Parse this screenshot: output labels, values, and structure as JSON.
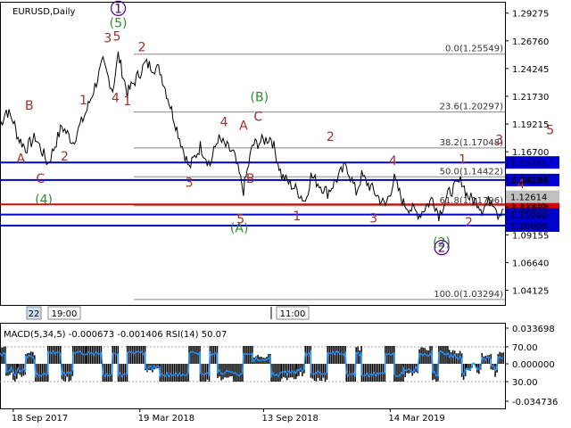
{
  "chart_data": {
    "type": "line",
    "title": "EURUSD,Daily",
    "y_axis": {
      "ticks": [
        "1.29275",
        "1.26760",
        "1.24245",
        "1.21730",
        "1.19215",
        "1.16700",
        "1.14185",
        "1.11670",
        "1.09155",
        "1.06640",
        "1.04125"
      ],
      "ylim": [
        1.028,
        1.303
      ]
    },
    "x_axis": {
      "ticks": [
        "18 Sep 2017",
        "19 Mar 2018",
        "13 Sep 2018",
        "14 Mar 2019"
      ],
      "xlim": [
        "2017-08-30",
        "2019-08-26"
      ],
      "time_markers": [
        "22",
        "19:00",
        "11:00"
      ]
    },
    "price_series": {
      "name": "EURUSD",
      "points": [
        [
          "2017-08-30",
          1.19
        ],
        [
          "2017-09-08",
          1.205
        ],
        [
          "2017-09-18",
          1.195
        ],
        [
          "2017-09-25",
          1.18
        ],
        [
          "2017-10-06",
          1.17
        ],
        [
          "2017-10-20",
          1.18
        ],
        [
          "2017-11-07",
          1.156
        ],
        [
          "2017-11-27",
          1.19
        ],
        [
          "2017-12-13",
          1.176
        ],
        [
          "2018-01-02",
          1.205
        ],
        [
          "2018-01-25",
          1.248
        ],
        [
          "2018-02-08",
          1.223
        ],
        [
          "2018-02-16",
          1.255
        ],
        [
          "2018-03-01",
          1.22
        ],
        [
          "2018-03-27",
          1.247
        ],
        [
          "2018-04-17",
          1.241
        ],
        [
          "2018-05-15",
          1.18
        ],
        [
          "2018-05-29",
          1.152
        ],
        [
          "2018-06-14",
          1.172
        ],
        [
          "2018-06-28",
          1.155
        ],
        [
          "2018-07-09",
          1.179
        ],
        [
          "2018-08-01",
          1.165
        ],
        [
          "2018-08-15",
          1.132
        ],
        [
          "2018-08-28",
          1.173
        ],
        [
          "2018-09-24",
          1.18
        ],
        [
          "2018-10-09",
          1.145
        ],
        [
          "2018-10-31",
          1.132
        ],
        [
          "2018-11-12",
          1.122
        ],
        [
          "2018-11-20",
          1.145
        ],
        [
          "2018-12-14",
          1.13
        ],
        [
          "2019-01-10",
          1.155
        ],
        [
          "2019-01-24",
          1.13
        ],
        [
          "2019-02-01",
          1.145
        ],
        [
          "2019-03-07",
          1.118
        ],
        [
          "2019-03-20",
          1.142
        ],
        [
          "2019-04-02",
          1.12
        ],
        [
          "2019-04-25",
          1.11
        ],
        [
          "2019-05-14",
          1.125
        ],
        [
          "2019-05-23",
          1.11
        ],
        [
          "2019-06-07",
          1.13
        ],
        [
          "2019-06-25",
          1.141
        ],
        [
          "2019-07-02",
          1.128
        ],
        [
          "2019-07-10",
          1.123
        ],
        [
          "2019-07-17",
          1.122
        ],
        [
          "2019-07-24",
          1.115
        ],
        [
          "2019-08-06",
          1.124
        ],
        [
          "2019-08-12",
          1.12
        ],
        [
          "2019-08-16",
          1.11
        ],
        [
          "2019-08-26",
          1.119
        ]
      ]
    },
    "fibonacci_levels": [
      {
        "label": "0.0(1.25549)",
        "value": 1.25549
      },
      {
        "label": "23.6(1.20297)",
        "value": 1.20297
      },
      {
        "label": "38.2(1.17048)",
        "value": 1.17048
      },
      {
        "label": "50.0(1.14422)",
        "value": 1.14422
      },
      {
        "label": "61.8(1.11796)",
        "value": 1.11796
      },
      {
        "label": "100.0(1.03294)",
        "value": 1.03294
      }
    ],
    "horizontal_levels": [
      {
        "value": 1.15725,
        "label": "1.15725",
        "color": "#0000cc"
      },
      {
        "value": 1.14134,
        "label": "1.14134",
        "color": "#0000cc"
      },
      {
        "value": 1.11915,
        "label": "1.11915",
        "color": "#dd0000"
      },
      {
        "value": 1.11,
        "label": "1.11000",
        "color": "#0000cc"
      },
      {
        "value": 1.1,
        "label": "1.10000",
        "color": "#0000cc"
      }
    ],
    "current_price": {
      "label": "1.12614",
      "value": 1.12614
    },
    "wave_labels": [
      {
        "text": "1",
        "date": "2018-02-16",
        "price": 1.293,
        "color": "#4b0082",
        "circled": true
      },
      {
        "text": "(5)",
        "date": "2018-02-16",
        "price": 1.28,
        "color": "#2e8b2e",
        "circled": false
      },
      {
        "text": "3",
        "date": "2018-02-01",
        "price": 1.266,
        "color": "#a0302c",
        "circled": false
      },
      {
        "text": "5",
        "date": "2018-02-14",
        "price": 1.268,
        "color": "#a0302c",
        "circled": false
      },
      {
        "text": "2",
        "date": "2018-03-22",
        "price": 1.258,
        "color": "#a0302c",
        "circled": false
      },
      {
        "text": "4",
        "date": "2018-02-12",
        "price": 1.212,
        "color": "#a0302c",
        "circled": false
      },
      {
        "text": "1",
        "date": "2018-03-01",
        "price": 1.209,
        "color": "#a0302c",
        "circled": false
      },
      {
        "text": "1",
        "date": "2017-12-28",
        "price": 1.21,
        "color": "#a0302c",
        "circled": false
      },
      {
        "text": "B",
        "date": "2017-10-11",
        "price": 1.205,
        "color": "#a0302c",
        "circled": false
      },
      {
        "text": "A",
        "date": "2017-09-29",
        "price": 1.157,
        "color": "#a0302c",
        "circled": false
      },
      {
        "text": "2",
        "date": "2017-12-01",
        "price": 1.159,
        "color": "#a0302c",
        "circled": false
      },
      {
        "text": "C",
        "date": "2017-10-27",
        "price": 1.139,
        "color": "#a0302c",
        "circled": false
      },
      {
        "text": "(4)",
        "date": "2017-11-01",
        "price": 1.12,
        "color": "#2e8b2e",
        "circled": false
      },
      {
        "text": "3",
        "date": "2018-05-29",
        "price": 1.135,
        "color": "#a0302c",
        "circled": false
      },
      {
        "text": "4",
        "date": "2018-07-18",
        "price": 1.19,
        "color": "#a0302c",
        "circled": false
      },
      {
        "text": "A",
        "date": "2018-08-15",
        "price": 1.187,
        "color": "#a0302c",
        "circled": false
      },
      {
        "text": "C",
        "date": "2018-09-05",
        "price": 1.195,
        "color": "#a0302c",
        "circled": false
      },
      {
        "text": "(B)",
        "date": "2018-09-07",
        "price": 1.213,
        "color": "#2e8b2e",
        "circled": false
      },
      {
        "text": "B",
        "date": "2018-08-25",
        "price": 1.139,
        "color": "#a0302c",
        "circled": false
      },
      {
        "text": "5",
        "date": "2018-08-11",
        "price": 1.102,
        "color": "#a0302c",
        "circled": false
      },
      {
        "text": "(A)",
        "date": "2018-08-09",
        "price": 1.094,
        "color": "#2e8b2e",
        "circled": false
      },
      {
        "text": "1",
        "date": "2018-10-31",
        "price": 1.105,
        "color": "#a0302c",
        "circled": false
      },
      {
        "text": "2",
        "date": "2018-12-18",
        "price": 1.177,
        "color": "#a0302c",
        "circled": false
      },
      {
        "text": "3",
        "date": "2019-02-18",
        "price": 1.103,
        "color": "#a0302c",
        "circled": false
      },
      {
        "text": "4",
        "date": "2019-03-18",
        "price": 1.155,
        "color": "#a0302c",
        "circled": false
      },
      {
        "text": "1",
        "date": "2019-06-26",
        "price": 1.156,
        "color": "#a0302c",
        "circled": false
      },
      {
        "text": "2",
        "date": "2019-07-05",
        "price": 1.099,
        "color": "#a0302c",
        "circled": false
      },
      {
        "text": "(2)",
        "date": "2019-05-27",
        "price": 1.081,
        "color": "#2e8b2e",
        "circled": false
      },
      {
        "text": "2",
        "date": "2019-05-27",
        "price": 1.076,
        "color": "#4b0082",
        "circled": true
      },
      {
        "text": "3",
        "date": "2019-08-18",
        "price": 1.174,
        "color": "#a0302c",
        "circled": false
      },
      {
        "text": "4",
        "date": "2019-09-18",
        "price": 1.134,
        "color": "#a0302c",
        "circled": false
      },
      {
        "text": "5",
        "date": "2019-10-30",
        "price": 1.183,
        "color": "#a0302c",
        "circled": false
      }
    ],
    "indicator": {
      "label": "MACD(5,34,5) -0.000673 -0.001406 RSI(14) 50.07",
      "ticks": [
        "0.033698",
        "70.00",
        "0.000000",
        "30.00",
        "-0.034736"
      ]
    }
  }
}
